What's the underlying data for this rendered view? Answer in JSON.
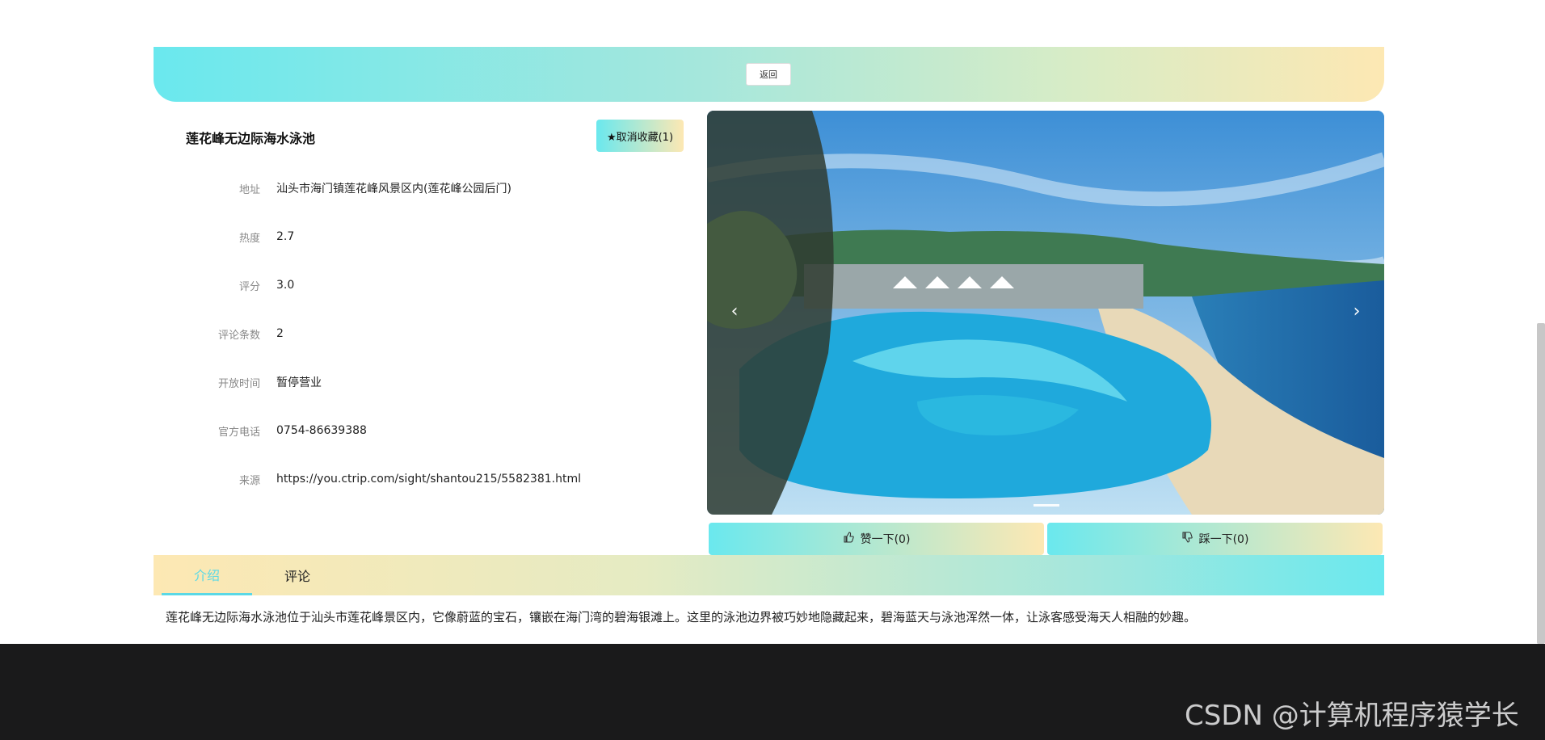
{
  "header": {
    "back_label": "返回"
  },
  "scenic": {
    "title": "莲花峰无边际海水泳池",
    "favorite_label": "★取消收藏(1)"
  },
  "info": [
    {
      "label": "地址",
      "value": "汕头市海门镇莲花峰风景区内(莲花峰公园后门)"
    },
    {
      "label": "热度",
      "value": "2.7"
    },
    {
      "label": "评分",
      "value": "3.0"
    },
    {
      "label": "评论条数",
      "value": "2"
    },
    {
      "label": "开放时间",
      "value": "暂停营业"
    },
    {
      "label": "官方电话",
      "value": "0754-86639388"
    },
    {
      "label": "来源",
      "value": "https://you.ctrip.com/sight/shantou215/5582381.html"
    }
  ],
  "carousel": {
    "prev_icon": "‹",
    "next_icon": "›",
    "icons": [
      "chevron-left-icon",
      "chevron-right-icon"
    ]
  },
  "votes": {
    "like_label": "赞一下(0)",
    "dislike_label": "踩一下(0)",
    "icons": [
      "thumbs-up-icon",
      "thumbs-down-icon"
    ]
  },
  "tabs": [
    {
      "label": "介绍"
    },
    {
      "label": "评论"
    }
  ],
  "intro_text": "莲花峰无边际海水泳池位于汕头市莲花峰景区内，它像蔚蓝的宝石，镶嵌在海门湾的碧海银滩上。这里的泳池边界被巧妙地隐藏起来，碧海蓝天与泳池浑然一体，让泳客感受海天人相融的妙趣。",
  "footer": {
    "watermark": "CSDN @计算机程序猿学长"
  },
  "colors": {
    "accent": "#5ad8e6",
    "gradient_start": "#6ae8ee",
    "gradient_end": "#fde8b3",
    "footer_bg": "#1a1a1b"
  }
}
